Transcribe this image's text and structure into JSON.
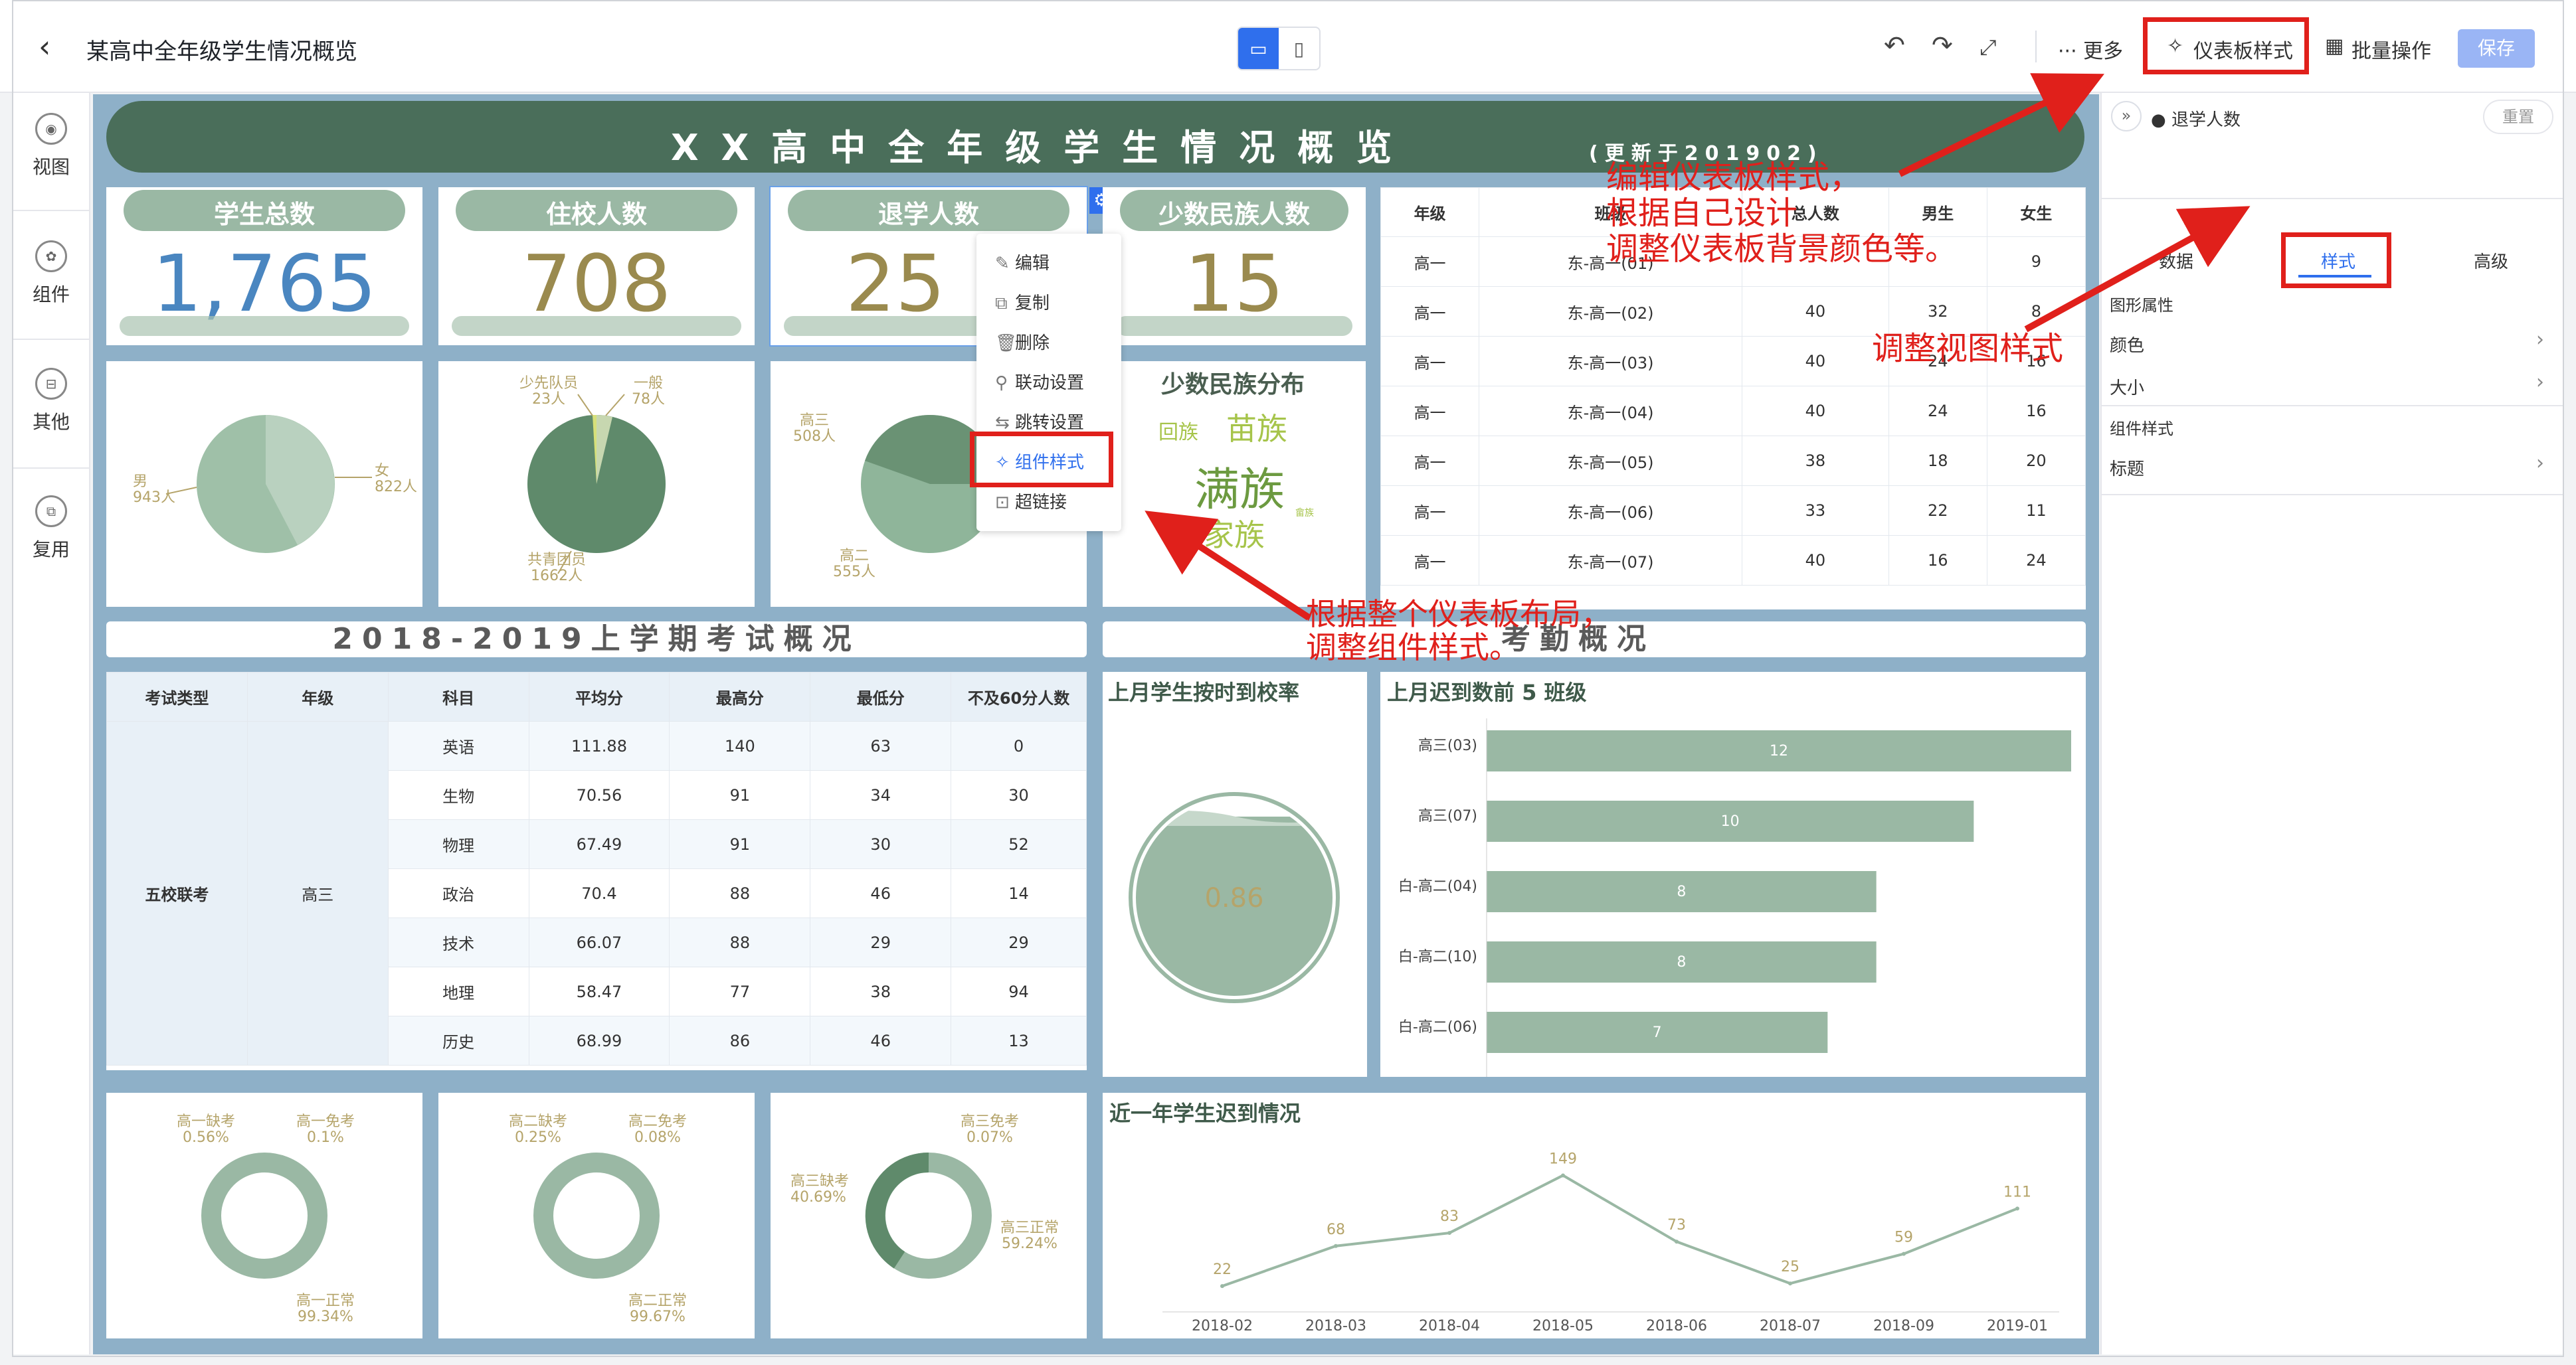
{
  "topbar": {
    "title": "某高中全年级学生情况概览",
    "more_label": "··· 更多",
    "dashboard_style_label": "仪表板样式",
    "batch_label": "批量操作",
    "save_label": "保存"
  },
  "leftrail": {
    "items": [
      {
        "label": "视图"
      },
      {
        "label": "组件"
      },
      {
        "label": "其他"
      },
      {
        "label": "复用"
      }
    ]
  },
  "banner": {
    "title": "XX高中全年级学生情况概览",
    "subtitle": "(更新于201902)"
  },
  "kpis": [
    {
      "label": "学生总数",
      "value": "1,765",
      "color": "#4a86c0"
    },
    {
      "label": "住校人数",
      "value": "708",
      "color": "#9a8a4e"
    },
    {
      "label": "退学人数",
      "value": "25",
      "color": "#9a8a4e"
    },
    {
      "label": "少数民族人数",
      "value": "15",
      "color": "#9a8a4e"
    }
  ],
  "class_table": {
    "headers": [
      "年级",
      "班级",
      "总人数",
      "男生",
      "女生"
    ],
    "rows": [
      [
        "高一",
        "东-高一(01)",
        "",
        "",
        "9"
      ],
      [
        "高一",
        "东-高一(02)",
        "40",
        "32",
        "8"
      ],
      [
        "高一",
        "东-高一(03)",
        "40",
        "24",
        "16"
      ],
      [
        "高一",
        "东-高一(04)",
        "40",
        "24",
        "16"
      ],
      [
        "高一",
        "东-高一(05)",
        "38",
        "18",
        "20"
      ],
      [
        "高一",
        "东-高一(06)",
        "33",
        "22",
        "11"
      ],
      [
        "高一",
        "东-高一(07)",
        "40",
        "16",
        "24"
      ]
    ]
  },
  "pies": {
    "gender": {
      "male": "男\n943人",
      "female": "女\n822人"
    },
    "political": {
      "a": "少先队员\n23人",
      "b": "一般\n78人",
      "c": "共青团员\n1662人"
    },
    "grade": {
      "a": "高三\n508人",
      "b": "高二\n555人"
    }
  },
  "ethnic": {
    "title": "少数民族分布",
    "words": [
      "回族",
      "苗族",
      "满族",
      "家族",
      "畲族"
    ]
  },
  "context_menu": {
    "items": [
      "编辑",
      "复制",
      "删除",
      "联动设置",
      "跳转设置",
      "组件样式",
      "超链接"
    ]
  },
  "exam": {
    "section_title": "2018-2019上学期考试概况",
    "headers": [
      "考试类型",
      "年级",
      "科目",
      "平均分",
      "最高分",
      "最低分",
      "不及60分人数"
    ],
    "exam_type": "五校联考",
    "grade": "高三",
    "rows": [
      [
        "英语",
        "111.88",
        "140",
        "63",
        "0"
      ],
      [
        "生物",
        "70.56",
        "91",
        "34",
        "30"
      ],
      [
        "物理",
        "67.49",
        "91",
        "30",
        "52"
      ],
      [
        "政治",
        "70.4",
        "88",
        "46",
        "14"
      ],
      [
        "技术",
        "66.07",
        "88",
        "29",
        "29"
      ],
      [
        "地理",
        "58.47",
        "77",
        "38",
        "94"
      ],
      [
        "历史",
        "68.99",
        "86",
        "46",
        "13"
      ]
    ]
  },
  "attendance": {
    "section_title": "考勤概况",
    "ontime_title": "上月学生按时到校率",
    "ontime_value": "0.86",
    "late_title": "上月迟到数前 5 班级",
    "late_bars": [
      {
        "label": "高三(03)",
        "value": 12
      },
      {
        "label": "高三(07)",
        "value": 10
      },
      {
        "label": "白-高二(04)",
        "value": 8
      },
      {
        "label": "白-高二(10)",
        "value": 8
      },
      {
        "label": "白-高二(06)",
        "value": 7
      }
    ],
    "trend_title": "近一年学生迟到情况"
  },
  "donuts": [
    {
      "a": "高一缺考\n0.56%",
      "b": "高一免考\n0.1%",
      "c": "高一正常\n99.34%"
    },
    {
      "a": "高二缺考\n0.25%",
      "b": "高二免考\n0.08%",
      "c": "高二正常\n99.67%"
    },
    {
      "a": "高三缺考\n40.69%",
      "b": "高三免考\n0.07%",
      "c": "高三正常\n59.24%"
    }
  ],
  "chart_data": {
    "type": "line",
    "title": "近一年学生迟到情况",
    "x": [
      "2018-02",
      "2018-03",
      "2018-04",
      "2018-05",
      "2018-06",
      "2018-07",
      "2018-09",
      "2019-01"
    ],
    "values": [
      22,
      68,
      83,
      149,
      73,
      25,
      59,
      111
    ]
  },
  "rpanel": {
    "header": "退学人数",
    "reset": "重置",
    "tabs": [
      "数据",
      "样式",
      "高级"
    ],
    "section1": "图形属性",
    "color": "颜色",
    "size": "大小",
    "section2": "组件样式",
    "title_row": "标题"
  },
  "annotations": {
    "a1": "编辑仪表板样式，\n根据自己设计\n调整仪表板背景颜色等。",
    "a2": "调整视图样式",
    "a3": "根据整个仪表板布局，\n调整组件样式。"
  },
  "colors": {
    "accent": "#2f6fed",
    "green_dark": "#4a6e5a",
    "green_light": "#9ab8a4",
    "canvas_bg": "#8eb0c8",
    "annotation_red": "#e0201b"
  }
}
